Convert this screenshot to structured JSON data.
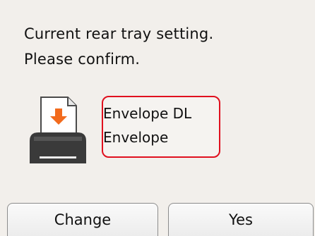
{
  "dialog": {
    "message_line1": "Current rear tray setting.",
    "message_line2": "Please confirm."
  },
  "setting": {
    "paper_size": "Envelope DL",
    "media_type": "Envelope",
    "highlight_color": "#e0101e"
  },
  "icon": {
    "name": "printer-rear-tray-feed-icon",
    "arrow_color": "#f26b1d"
  },
  "buttons": {
    "change_label": "Change",
    "yes_label": "Yes"
  }
}
